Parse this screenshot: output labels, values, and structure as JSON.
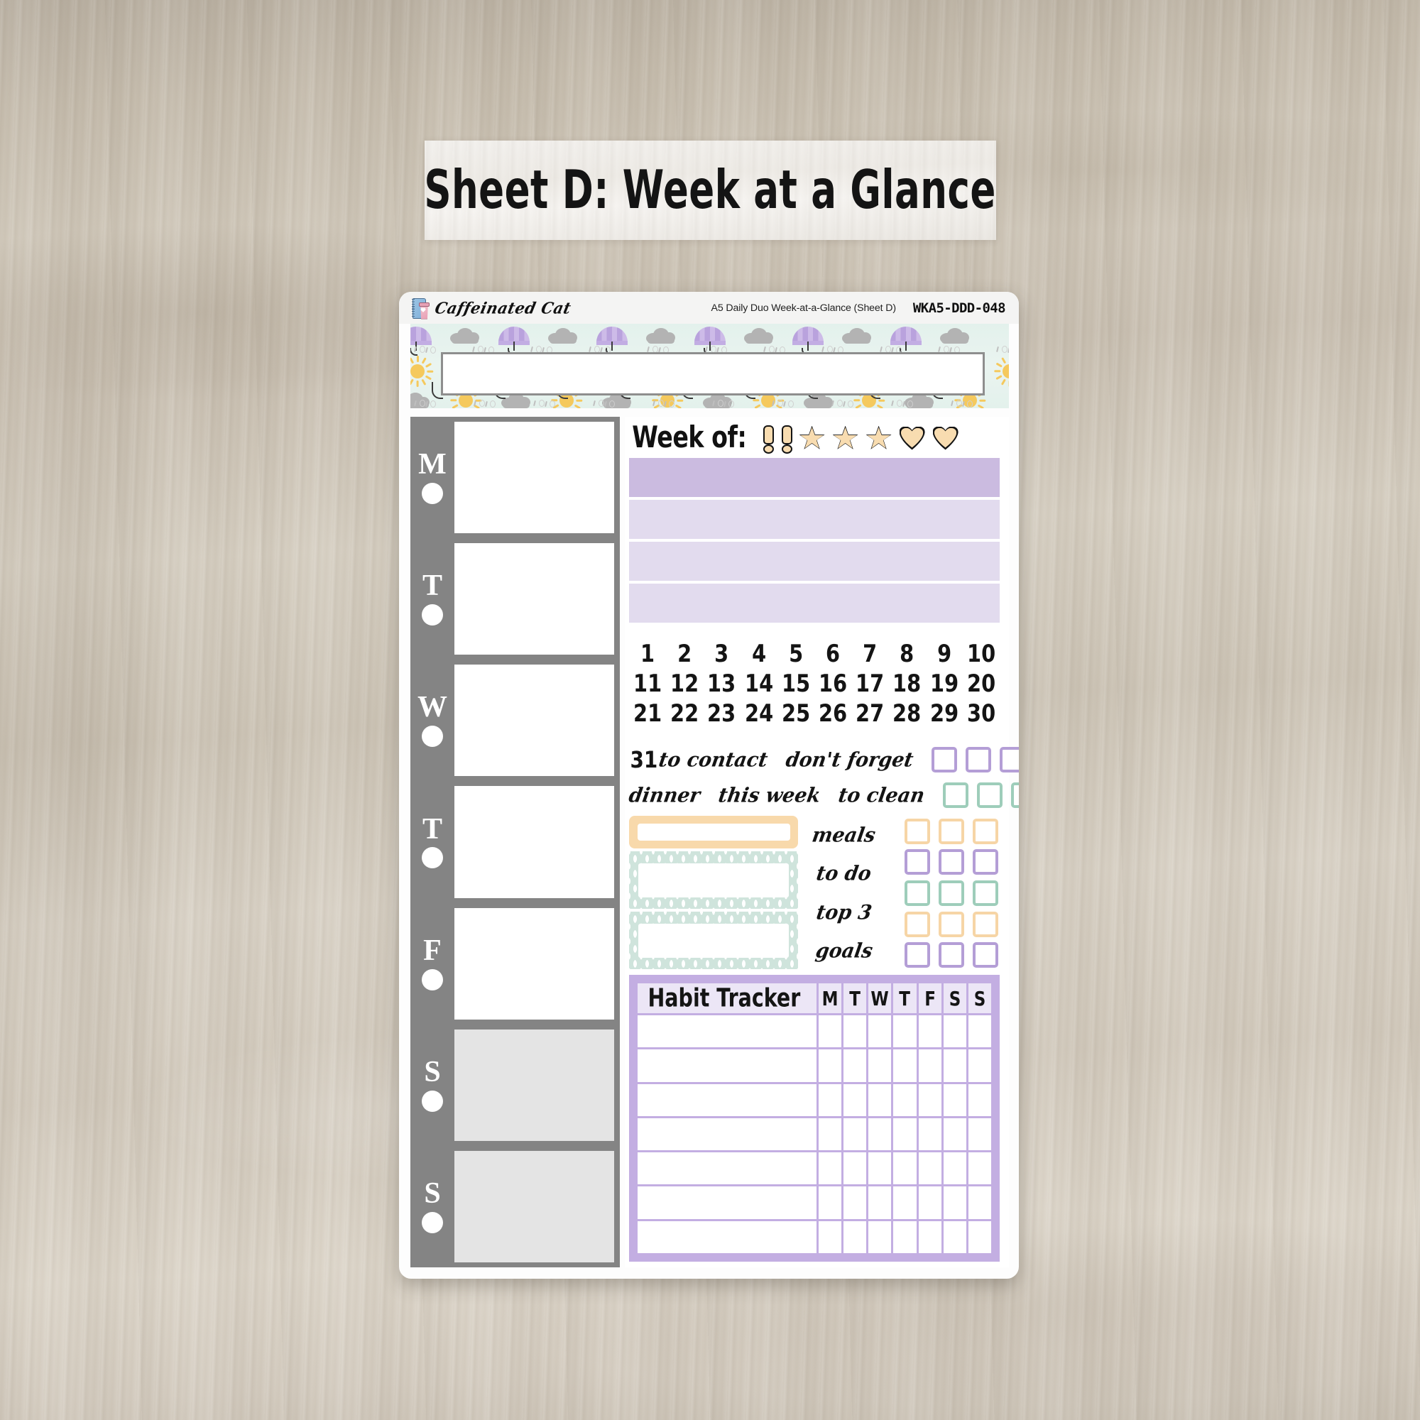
{
  "title_banner": {
    "text": "Sheet D: Week at a Glance"
  },
  "sheet_header": {
    "brand": "Caffeinated Cat",
    "description": "A5 Daily Duo Week-at-a-Glance (Sheet D)",
    "sku": "WKA5-DDD-048",
    "logo_icon": "notebook-coffee-icon"
  },
  "pattern_strip": {
    "icons": [
      "umbrella-icon",
      "cloud-icon",
      "sun-icon",
      "rain-icon"
    ],
    "background_color": "#e3f1ec",
    "umbrella_color": "#b9a2dd",
    "cloud_color": "#b3b3b3",
    "sun_color": "#f5c95d"
  },
  "days_panel": {
    "background_color": "#848484",
    "days": [
      {
        "letter": "M",
        "weekend": false
      },
      {
        "letter": "T",
        "weekend": false
      },
      {
        "letter": "W",
        "weekend": false
      },
      {
        "letter": "T",
        "weekend": false
      },
      {
        "letter": "F",
        "weekend": false
      },
      {
        "letter": "S",
        "weekend": true
      },
      {
        "letter": "S",
        "weekend": true
      }
    ]
  },
  "week_of": {
    "label": "Week of:",
    "icons": [
      "exclamation-icon",
      "exclamation-icon",
      "star-icon",
      "star-icon",
      "star-icon",
      "heart-icon",
      "heart-icon"
    ],
    "icon_fill": "#f8dcb0"
  },
  "bars": [
    {
      "color": "#cbbbe0"
    },
    {
      "color": "#e2dbee"
    },
    {
      "color": "#e2dbee"
    },
    {
      "color": "#e2dbee"
    }
  ],
  "dates": {
    "row1": [
      "1",
      "2",
      "3",
      "4",
      "5",
      "6",
      "7",
      "8",
      "9",
      "10"
    ],
    "row2": [
      "11",
      "12",
      "13",
      "14",
      "15",
      "16",
      "17",
      "18",
      "19",
      "20"
    ],
    "row3": [
      "21",
      "22",
      "23",
      "24",
      "25",
      "26",
      "27",
      "28",
      "29",
      "30"
    ],
    "last": "31"
  },
  "label_rows": [
    {
      "items": [
        "to contact",
        "don't forget"
      ],
      "checkbox_color": "purple",
      "checkbox_count": 3
    },
    {
      "items": [
        "dinner",
        "this week",
        "to clean"
      ],
      "checkbox_color": "green",
      "checkbox_count": 3
    }
  ],
  "mid_section": {
    "labels": [
      "meals",
      "to do",
      "top 3",
      "goals"
    ],
    "checkbox_rows": [
      {
        "color": "orange",
        "count": 3
      },
      {
        "color": "purple",
        "count": 3
      },
      {
        "color": "green",
        "count": 3
      },
      {
        "color": "orange",
        "count": 3
      },
      {
        "color": "purple",
        "count": 3
      }
    ],
    "orange_box_color": "#f8d9ab",
    "mint_box_color": "#cfe4dc"
  },
  "habit_tracker": {
    "title": "Habit Tracker",
    "day_headers": [
      "M",
      "T",
      "W",
      "T",
      "F",
      "S",
      "S"
    ],
    "row_count": 7,
    "frame_color": "#c3aee2"
  },
  "colors": {
    "purple_accent": "#b49ed6",
    "green_accent": "#9ecdba",
    "orange_accent": "#f6d5a6",
    "gray_panel": "#848484"
  }
}
